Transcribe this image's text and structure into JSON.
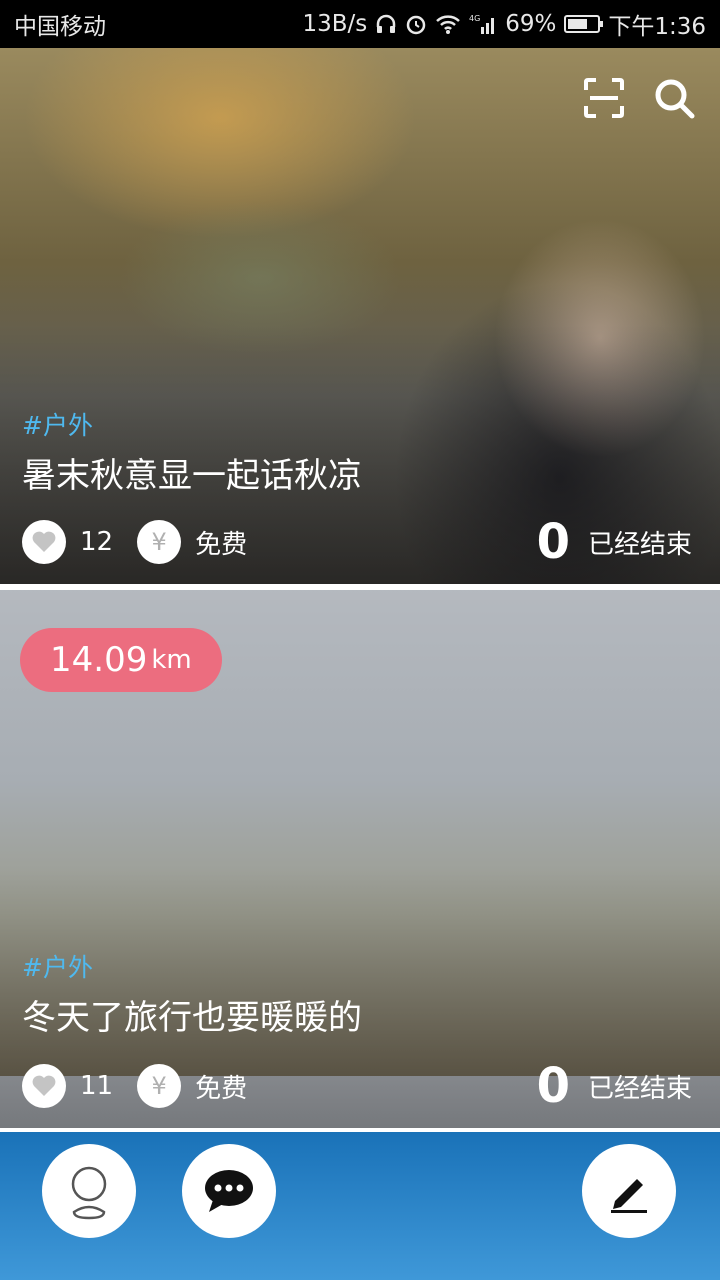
{
  "status_bar": {
    "carrier": "中国移动",
    "speed": "13B/s",
    "battery": "69%",
    "battery_level": 0.69,
    "time": "下午1:36",
    "network": "4G"
  },
  "top_actions": {
    "scan_icon": "scan-icon",
    "search_icon": "search-icon"
  },
  "cards": [
    {
      "tag": "#户外",
      "title": "暑末秋意显一起话秋凉",
      "likes": "12",
      "price": "免费",
      "count": "0",
      "status": "已经结束"
    },
    {
      "distance_value": "14.09",
      "distance_unit": "km",
      "tag": "#户外",
      "title": "冬天了旅行也要暖暖的",
      "likes": "11",
      "price": "免费",
      "count": "0",
      "status": "已经结束"
    }
  ],
  "bottom_bar": {
    "buttons": [
      "profile-icon",
      "chat-icon",
      "edit-icon"
    ]
  },
  "colors": {
    "tag": "#4fb9ef",
    "distance_badge": "#ec6d7f",
    "bottom_bar": "#2a83c6"
  }
}
